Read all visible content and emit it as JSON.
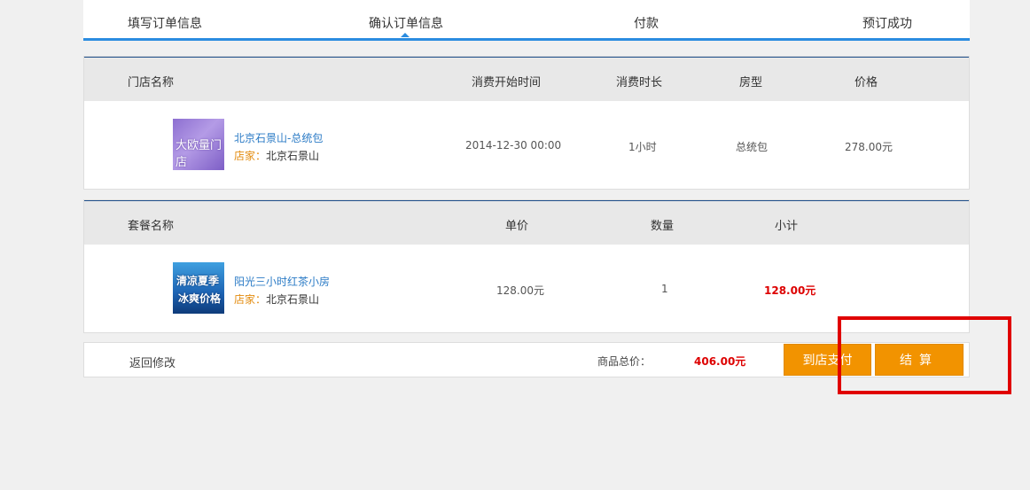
{
  "steps": [
    "填写订单信息",
    "确认订单信息",
    "付款",
    "预订成功"
  ],
  "store_table": {
    "headers": [
      "门店名称",
      "消费开始时间",
      "消费时长",
      "房型",
      "价格"
    ],
    "row": {
      "thumb_text": "大欧量门店",
      "name": "北京石景山-总统包",
      "shop_label": "店家：",
      "shop_name": "北京石景山",
      "start_time": "2014-12-30 00:00",
      "duration": "1小时",
      "room_type": "总统包",
      "price": "278.00元"
    }
  },
  "package_table": {
    "headers": [
      "套餐名称",
      "单价",
      "数量",
      "小计"
    ],
    "row": {
      "thumb_text_1": "清凉夏季",
      "thumb_text_2": "冰爽价格",
      "name": "阳光三小时红茶小房",
      "shop_label": "店家：",
      "shop_name": "北京石景山",
      "unit_price": "128.00元",
      "quantity": "1",
      "subtotal": "128.00元"
    }
  },
  "footer": {
    "back_label": "返回修改",
    "total_label": "商品总价：",
    "total_value": "406.00元",
    "pay_in_store_label": "到店支付",
    "checkout_label": "结算"
  },
  "colors": {
    "accent_blue": "#2b8ce0",
    "button_orange": "#f29300",
    "price_red": "#dd0000",
    "highlight_red": "#e00000"
  }
}
